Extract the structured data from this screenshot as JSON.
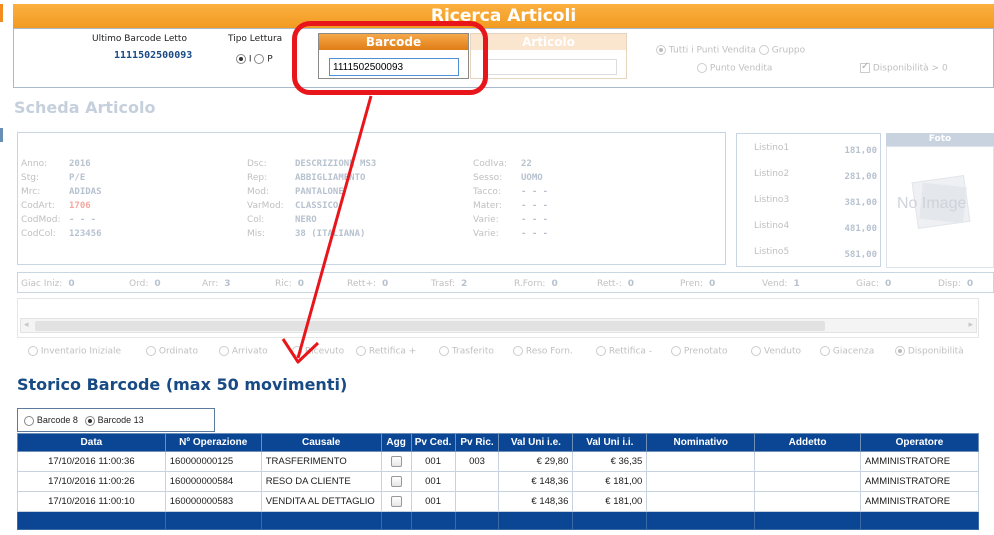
{
  "title": "Ricerca Articoli",
  "header": {
    "last_barcode_label": "Ultimo Barcode Letto",
    "last_barcode_value": "1111502500093",
    "tipo_lettura_label": "Tipo Lettura",
    "tipo_lettura_opt1": "I",
    "tipo_lettura_opt2": "P",
    "barcode_label": "Barcode",
    "barcode_value": "1111502500093",
    "articolo_label": "Articolo",
    "tutti_pv": "Tutti i Punti Vendita",
    "gruppo": "Gruppo",
    "punto_vendita": "Punto Vendita",
    "disponibilita": "Disponibilità > 0"
  },
  "scheda": {
    "title": "Scheda Articolo",
    "col1": [
      {
        "k": "Anno:",
        "v": "2016"
      },
      {
        "k": "Stg:",
        "v": "P/E"
      },
      {
        "k": "Mrc:",
        "v": "ADIDAS"
      },
      {
        "k": "CodArt:",
        "v": "1706"
      },
      {
        "k": "CodMod:",
        "v": "- - -"
      },
      {
        "k": "CodCol:",
        "v": "123456"
      }
    ],
    "col2": [
      {
        "k": "Dsc:",
        "v": "DESCRIZIONE MS3"
      },
      {
        "k": "Rep:",
        "v": "ABBIGLIAMENTO"
      },
      {
        "k": "Mod:",
        "v": "PANTALONE"
      },
      {
        "k": "VarMod:",
        "v": "CLASSICO"
      },
      {
        "k": "Col:",
        "v": "NERO"
      },
      {
        "k": "Mis:",
        "v": "38 (ITALIANA)"
      }
    ],
    "col3": [
      {
        "k": "CodIva:",
        "v": "22"
      },
      {
        "k": "Sesso:",
        "v": "UOMO"
      },
      {
        "k": "Tacco:",
        "v": "- - -"
      },
      {
        "k": "Mater:",
        "v": "- - -"
      },
      {
        "k": "Varie:",
        "v": "- - -"
      },
      {
        "k": "Varie:",
        "v": "- - -"
      }
    ],
    "listini": [
      {
        "k": "Listino1",
        "v": "181,00"
      },
      {
        "k": "Listino2",
        "v": "281,00"
      },
      {
        "k": "Listino3",
        "v": "381,00"
      },
      {
        "k": "Listino4",
        "v": "481,00"
      },
      {
        "k": "Listino5",
        "v": "581,00"
      }
    ],
    "foto_label": "Foto",
    "no_image": "No Image"
  },
  "quantities": [
    {
      "k": "Giac Iniz:",
      "v": "0"
    },
    {
      "k": "Ord:",
      "v": "0"
    },
    {
      "k": "Arr:",
      "v": "3"
    },
    {
      "k": "Ric:",
      "v": "0"
    },
    {
      "k": "Rett+:",
      "v": "0"
    },
    {
      "k": "Trasf:",
      "v": "2"
    },
    {
      "k": "R.Forn:",
      "v": "0"
    },
    {
      "k": "Rett-:",
      "v": "0"
    },
    {
      "k": "Pren:",
      "v": "0"
    },
    {
      "k": "Vend:",
      "v": "1"
    },
    {
      "k": "Giac:",
      "v": "0"
    },
    {
      "k": "Disp:",
      "v": "0"
    }
  ],
  "mov_options": [
    "Inventario Iniziale",
    "Ordinato",
    "Arrivato",
    "Ricevuto",
    "Rettifica +",
    "Trasferito",
    "Reso Forn.",
    "Rettifica -",
    "Prenotato",
    "Venduto",
    "Giacenza",
    "Disponibilità"
  ],
  "storico": {
    "title": "Storico Barcode (max 50 movimenti)",
    "opt_b8": "Barcode 8",
    "opt_b13": "Barcode 13",
    "columns": [
      "Data",
      "Nº Operazione",
      "Causale",
      "Agg",
      "Pv Ced.",
      "Pv Ric.",
      "Val Uni i.e.",
      "Val Uni i.i.",
      "Nominativo",
      "Addetto",
      "Operatore"
    ],
    "rows": [
      {
        "data": "17/10/2016 11:00:36",
        "op": "160000000125",
        "causale": "TRASFERIMENTO",
        "pvced": "001",
        "pvric": "003",
        "vie": "€ 29,80",
        "vii": "€ 36,35",
        "nom": "",
        "add": "",
        "oper": "AMMINISTRATORE"
      },
      {
        "data": "17/10/2016 11:00:26",
        "op": "160000000584",
        "causale": "RESO DA CLIENTE",
        "pvced": "001",
        "pvric": "",
        "vie": "€ 148,36",
        "vii": "€ 181,00",
        "nom": "",
        "add": "",
        "oper": "AMMINISTRATORE"
      },
      {
        "data": "17/10/2016 11:00:10",
        "op": "160000000583",
        "causale": "VENDITA AL DETTAGLIO",
        "pvced": "001",
        "pvric": "",
        "vie": "€ 148,36",
        "vii": "€ 181,00",
        "nom": "",
        "add": "",
        "oper": "AMMINISTRATORE"
      }
    ]
  },
  "colors": {
    "accent": "#f29b22",
    "grid_header": "#0b4694",
    "highlight": "#e8161a"
  }
}
